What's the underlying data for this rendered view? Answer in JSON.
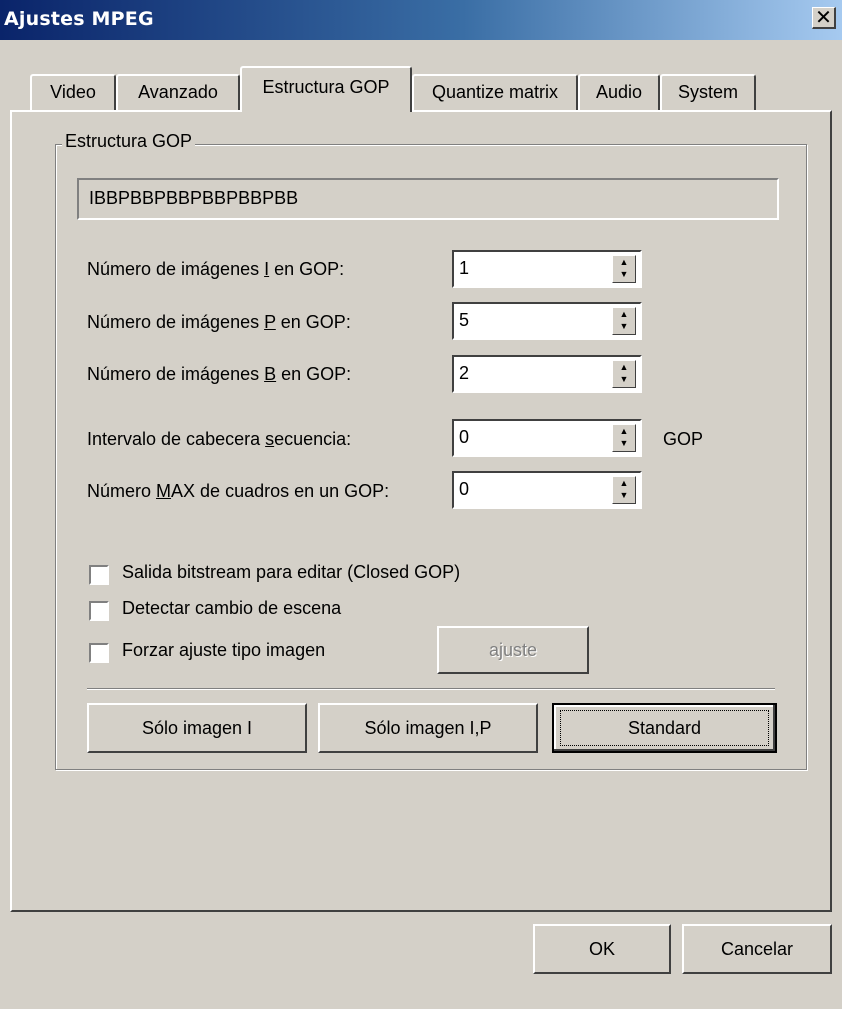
{
  "window": {
    "title": "Ajustes MPEG",
    "close_glyph": "✕"
  },
  "tabs": [
    {
      "label": "Video"
    },
    {
      "label": "Avanzado"
    },
    {
      "label": "Estructura GOP"
    },
    {
      "label": "Quantize matrix"
    },
    {
      "label": "Audio"
    },
    {
      "label": "System"
    }
  ],
  "active_tab": "Estructura GOP",
  "group": {
    "label": "Estructura GOP",
    "gop_pattern": "IBBPBBPBBPBBPBBPBB"
  },
  "fields": {
    "i_frames": {
      "label_pre": "Número de imágenes ",
      "label_key": "I",
      "label_post": " en GOP:",
      "value": "1"
    },
    "p_frames": {
      "label_pre": "Número de imágenes ",
      "label_key": "P",
      "label_post": " en GOP:",
      "value": "5"
    },
    "b_frames": {
      "label_pre": "Número de imágenes ",
      "label_key": "B",
      "label_post": " en GOP:",
      "value": "2"
    },
    "seq_header": {
      "label_pre": "Intervalo de cabecera ",
      "label_key": "s",
      "label_post": "ecuencia:",
      "value": "0",
      "unit": "GOP"
    },
    "max_frames": {
      "label_pre": "Número ",
      "label_key": "M",
      "label_post": "AX de cuadros en un GOP:",
      "value": "0"
    }
  },
  "checkboxes": [
    {
      "label": "Salida bitstream para editar (Closed GOP)",
      "checked": false
    },
    {
      "label": "Detectar cambio de escena",
      "checked": false
    },
    {
      "label": "Forzar ajuste tipo imagen",
      "checked": false
    }
  ],
  "buttons": {
    "ajuste": "ajuste",
    "solo_i": "Sólo imagen I",
    "solo_ip": "Sólo imagen I,P",
    "standard": "Standard",
    "ok": "OK",
    "cancel": "Cancelar"
  }
}
